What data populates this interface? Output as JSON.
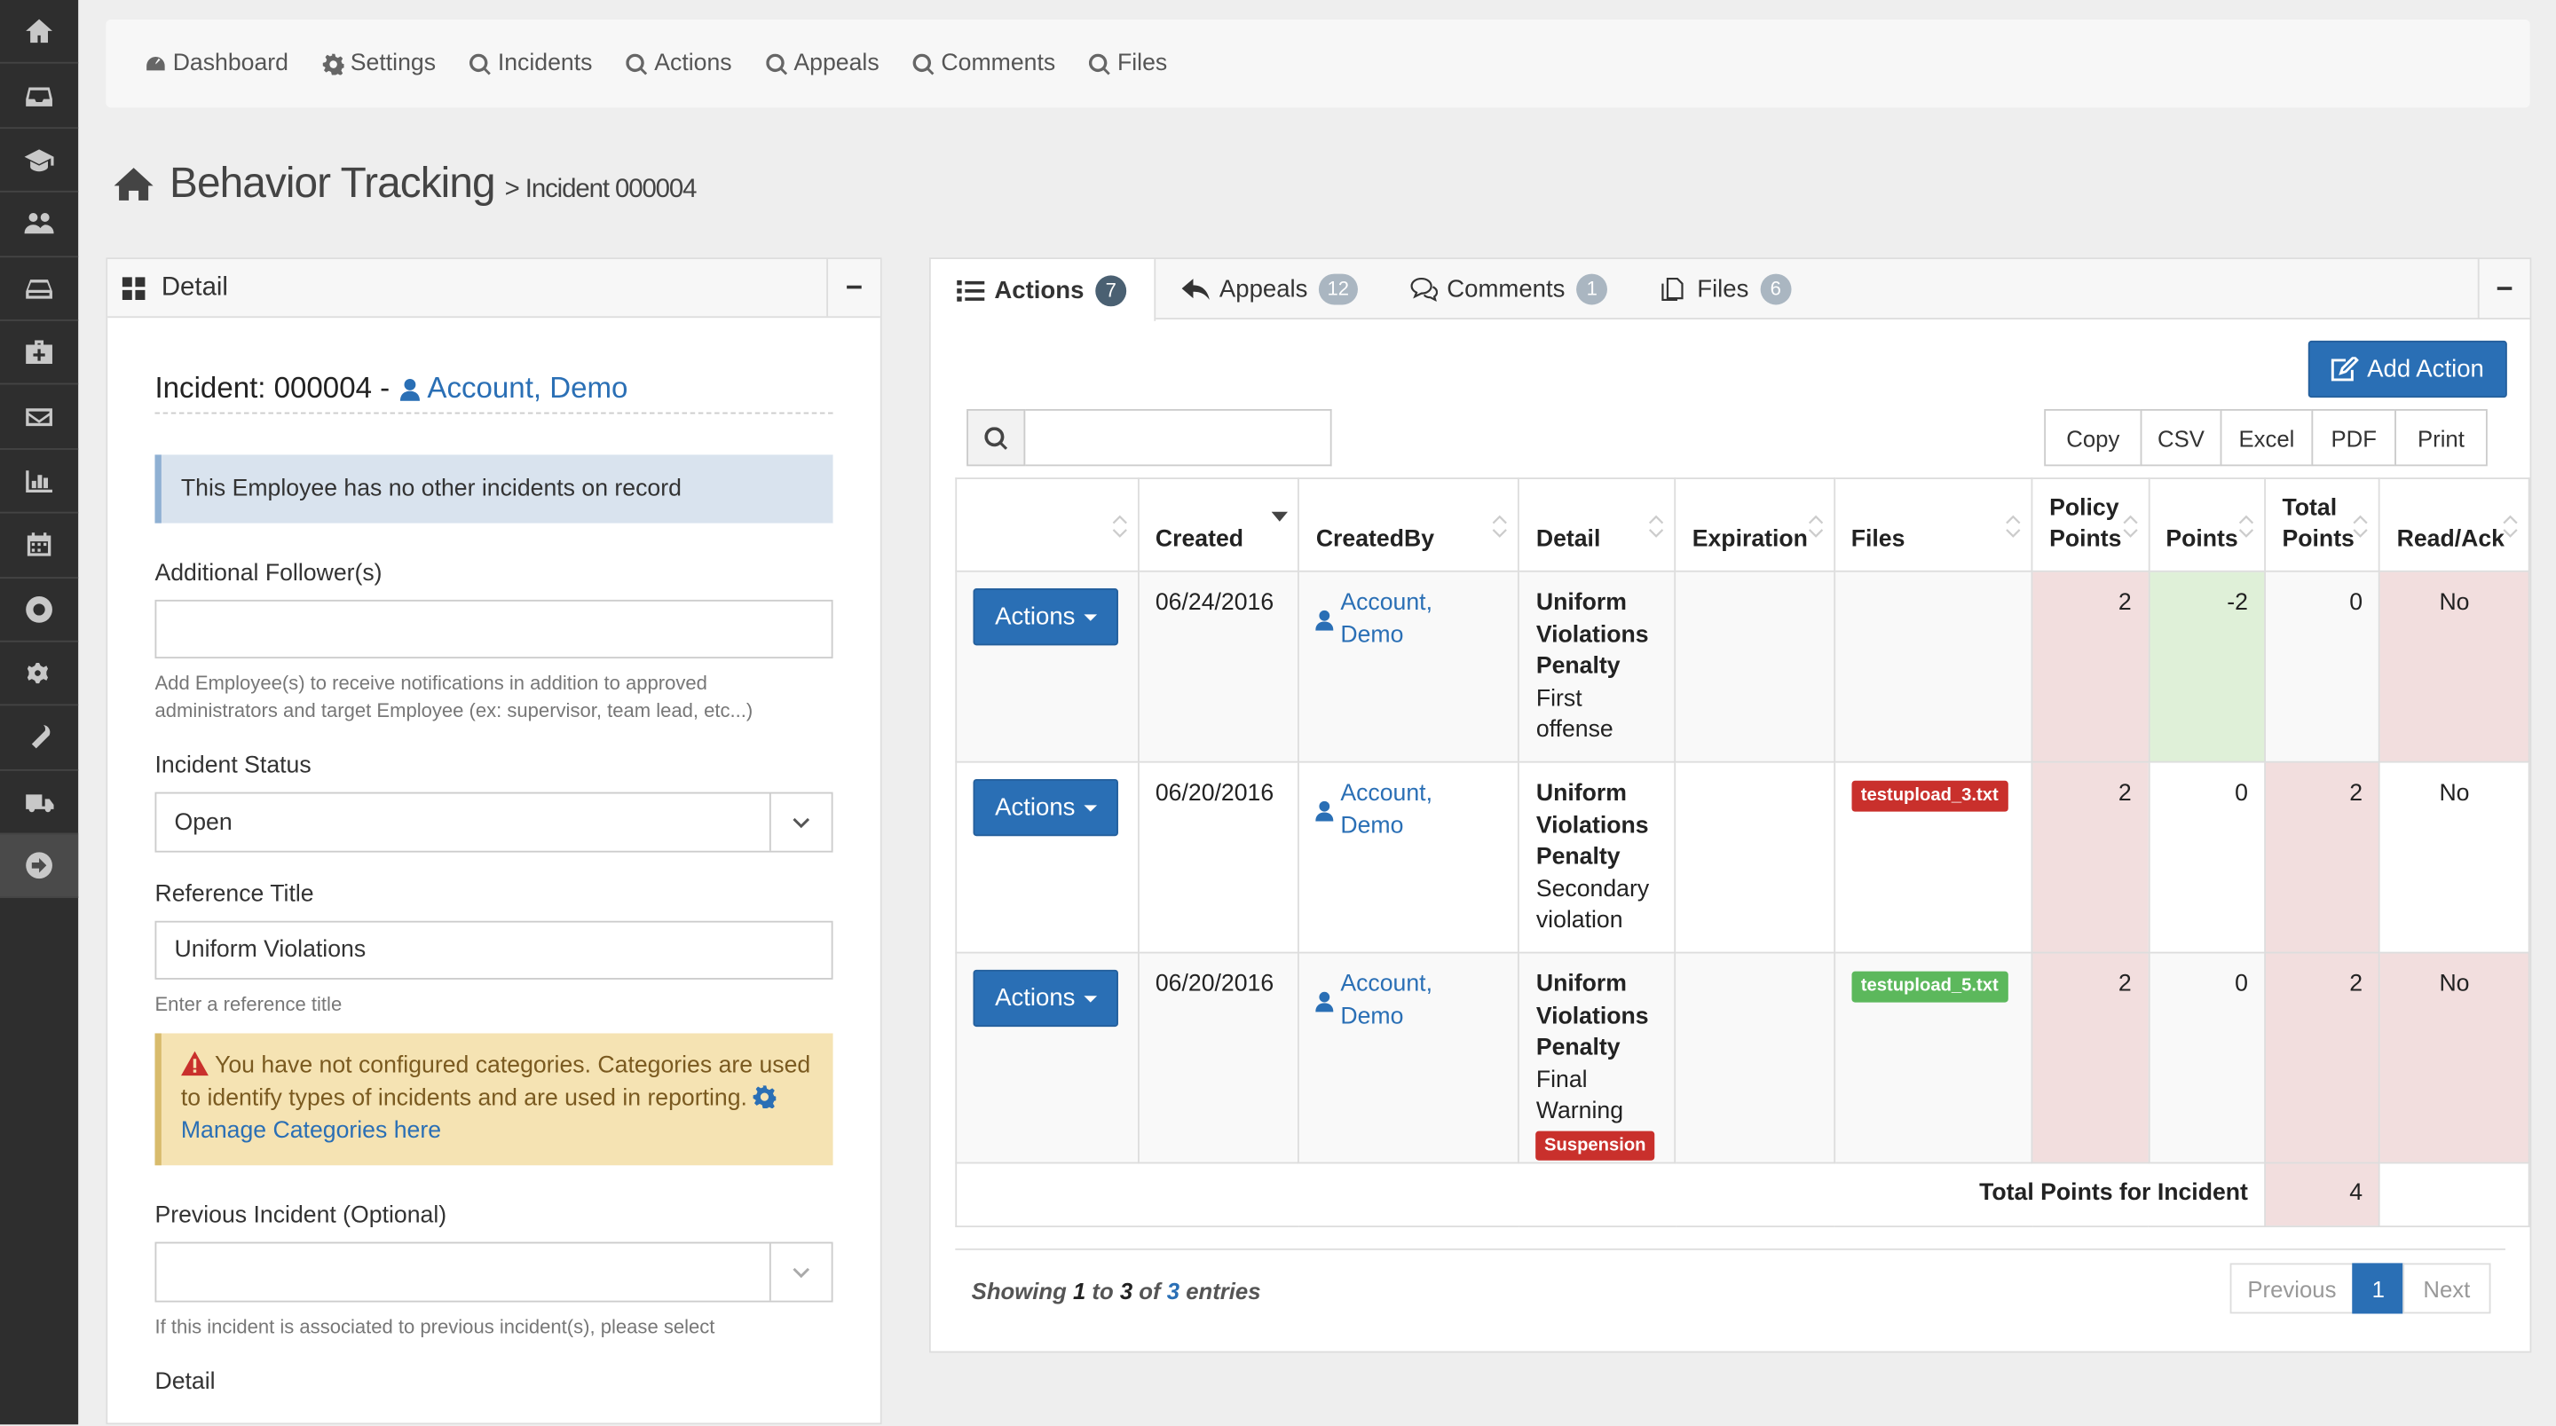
{
  "nav": {
    "items": [
      "Dashboard",
      "Settings",
      "Incidents",
      "Actions",
      "Appeals",
      "Comments",
      "Files"
    ]
  },
  "page": {
    "title": "Behavior Tracking",
    "subtitle": "> Incident 000004"
  },
  "detail": {
    "panel_title": "Detail",
    "collapse": "−",
    "incident_label": "Incident: 000004 -",
    "incident_account": "Account, Demo",
    "info_msg": "This Employee has no other incidents on record",
    "followers_label": "Additional Follower(s)",
    "followers_value": "",
    "followers_help": "Add Employee(s) to receive notifications in addition to approved administrators and target Employee (ex: supervisor, team lead, etc...)",
    "status_label": "Incident Status",
    "status_value": "Open",
    "ref_label": "Reference Title",
    "ref_value": "Uniform Violations",
    "ref_help": "Enter a reference title",
    "warn_text": "You have not configured categories. Categories are used to identify types of incidents and are used in reporting.",
    "warn_link": "Manage Categories here",
    "prev_label": "Previous Incident (Optional)",
    "prev_value": "",
    "prev_help": "If this incident is associated to previous incident(s), please select",
    "detail_label": "Detail"
  },
  "tabs": [
    {
      "label": "Actions",
      "count": "7"
    },
    {
      "label": "Appeals",
      "count": "12"
    },
    {
      "label": "Comments",
      "count": "1"
    },
    {
      "label": "Files",
      "count": "6"
    }
  ],
  "actions": {
    "add_label": "Add Action",
    "exports": [
      "Copy",
      "CSV",
      "Excel",
      "PDF",
      "Print"
    ],
    "search_value": "",
    "columns": [
      "",
      "Created",
      "CreatedBy",
      "Detail",
      "Expiration",
      "Files",
      "Policy Points",
      "Points",
      "Total Points",
      "Read/Ack"
    ],
    "button_label": "Actions",
    "rows": [
      {
        "created": "06/24/2016",
        "created_by": "Account, Demo",
        "detail_bold": "Uniform Violations Penalty",
        "detail_sub": "First offense",
        "tag": "",
        "expiration": "",
        "file": "",
        "policy": "2",
        "points": "-2",
        "total": "0",
        "read": "No"
      },
      {
        "created": "06/20/2016",
        "created_by": "Account, Demo",
        "detail_bold": "Uniform Violations Penalty",
        "detail_sub": "Secondary violation",
        "tag": "",
        "expiration": "",
        "file": "testupload_3.txt",
        "policy": "2",
        "points": "0",
        "total": "2",
        "read": "No"
      },
      {
        "created": "06/20/2016",
        "created_by": "Account, Demo",
        "detail_bold": "Uniform Violations Penalty",
        "detail_sub": "Final Warning",
        "tag": "Suspension",
        "expiration": "",
        "file": "testupload_5.txt",
        "policy": "2",
        "points": "0",
        "total": "2",
        "read": "No"
      }
    ],
    "footer_label": "Total Points for Incident",
    "footer_total": "4",
    "info": {
      "prefix": "Showing",
      "from": "1",
      "to_word": "to",
      "to": "3",
      "of_word": "of",
      "total": "3",
      "suffix": "entries"
    },
    "pager": {
      "prev": "Previous",
      "current": "1",
      "next": "Next"
    }
  },
  "colors": {
    "primary": "#2a6fb5",
    "danger": "#c9302c",
    "success": "#5cb85c",
    "pink": "#f2dede",
    "green": "#dff0d8"
  }
}
